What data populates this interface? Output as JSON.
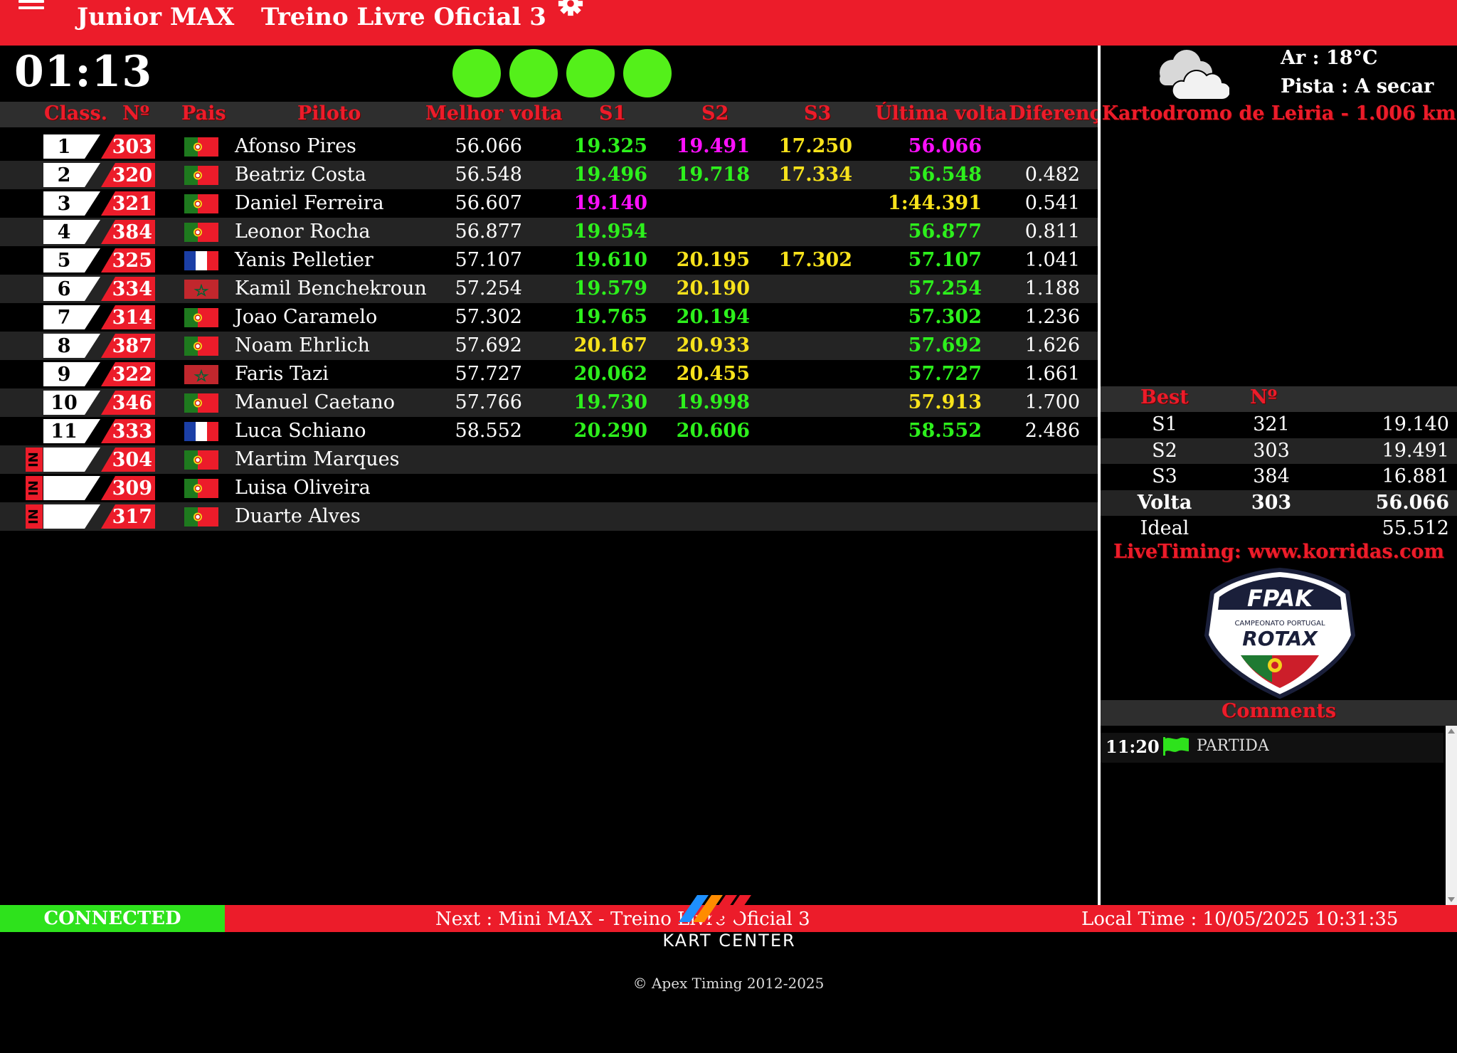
{
  "header": {
    "category": "Junior MAX",
    "session": "Treino Livre Oficial 3"
  },
  "clock": "01:13",
  "lights": [
    "#54f01a",
    "#54f01a",
    "#54f01a",
    "#54f01a"
  ],
  "table": {
    "headers": [
      "Class.",
      "Nº",
      "Pais",
      "Piloto",
      "Melhor volta",
      "S1",
      "S2",
      "S3",
      "Última volta",
      "Diferenç"
    ],
    "rows": [
      {
        "pos": "1",
        "num": "303",
        "flag": "PT",
        "pilot": "Afonso Pires",
        "best": "56.066",
        "s1": "19.325",
        "s1c": "green",
        "s2": "19.491",
        "s2c": "purple",
        "s3": "17.250",
        "s3c": "yellow",
        "last": "56.066",
        "lastc": "purple",
        "gap": ""
      },
      {
        "pos": "2",
        "num": "320",
        "flag": "PT",
        "pilot": "Beatriz Costa",
        "best": "56.548",
        "s1": "19.496",
        "s1c": "green",
        "s2": "19.718",
        "s2c": "green",
        "s3": "17.334",
        "s3c": "yellow",
        "last": "56.548",
        "lastc": "green",
        "gap": "0.482"
      },
      {
        "pos": "3",
        "num": "321",
        "flag": "PT",
        "pilot": "Daniel Ferreira",
        "best": "56.607",
        "s1": "19.140",
        "s1c": "purple",
        "s2": "",
        "s2c": "white",
        "s3": "",
        "s3c": "white",
        "last": "1:44.391",
        "lastc": "yellow",
        "gap": "0.541"
      },
      {
        "pos": "4",
        "num": "384",
        "flag": "PT",
        "pilot": "Leonor Rocha",
        "best": "56.877",
        "s1": "19.954",
        "s1c": "green",
        "s2": "",
        "s2c": "white",
        "s3": "",
        "s3c": "white",
        "last": "56.877",
        "lastc": "green",
        "gap": "0.811"
      },
      {
        "pos": "5",
        "num": "325",
        "flag": "FR",
        "pilot": "Yanis Pelletier",
        "best": "57.107",
        "s1": "19.610",
        "s1c": "green",
        "s2": "20.195",
        "s2c": "yellow",
        "s3": "17.302",
        "s3c": "yellow",
        "last": "57.107",
        "lastc": "green",
        "gap": "1.041"
      },
      {
        "pos": "6",
        "num": "334",
        "flag": "MA",
        "pilot": "Kamil Benchekroun",
        "best": "57.254",
        "s1": "19.579",
        "s1c": "green",
        "s2": "20.190",
        "s2c": "yellow",
        "s3": "",
        "s3c": "white",
        "last": "57.254",
        "lastc": "green",
        "gap": "1.188"
      },
      {
        "pos": "7",
        "num": "314",
        "flag": "PT",
        "pilot": "Joao Caramelo",
        "best": "57.302",
        "s1": "19.765",
        "s1c": "green",
        "s2": "20.194",
        "s2c": "green",
        "s3": "",
        "s3c": "white",
        "last": "57.302",
        "lastc": "green",
        "gap": "1.236"
      },
      {
        "pos": "8",
        "num": "387",
        "flag": "PT",
        "pilot": "Noam Ehrlich",
        "best": "57.692",
        "s1": "20.167",
        "s1c": "yellow",
        "s2": "20.933",
        "s2c": "yellow",
        "s3": "",
        "s3c": "white",
        "last": "57.692",
        "lastc": "green",
        "gap": "1.626"
      },
      {
        "pos": "9",
        "num": "322",
        "flag": "MA",
        "pilot": "Faris Tazi",
        "best": "57.727",
        "s1": "20.062",
        "s1c": "green",
        "s2": "20.455",
        "s2c": "yellow",
        "s3": "",
        "s3c": "white",
        "last": "57.727",
        "lastc": "green",
        "gap": "1.661"
      },
      {
        "pos": "10",
        "num": "346",
        "flag": "PT",
        "pilot": "Manuel Caetano",
        "best": "57.766",
        "s1": "19.730",
        "s1c": "green",
        "s2": "19.998",
        "s2c": "green",
        "s3": "",
        "s3c": "white",
        "last": "57.913",
        "lastc": "yellow",
        "gap": "1.700"
      },
      {
        "pos": "11",
        "num": "333",
        "flag": "FR",
        "pilot": "Luca Schiano",
        "best": "58.552",
        "s1": "20.290",
        "s1c": "green",
        "s2": "20.606",
        "s2c": "green",
        "s3": "",
        "s3c": "white",
        "last": "58.552",
        "lastc": "green",
        "gap": "2.486"
      },
      {
        "pos": "",
        "status": "IN",
        "num": "304",
        "flag": "PT",
        "pilot": "Martim Marques",
        "best": "",
        "s1": "",
        "s1c": "white",
        "s2": "",
        "s2c": "white",
        "s3": "",
        "s3c": "white",
        "last": "",
        "lastc": "white",
        "gap": ""
      },
      {
        "pos": "",
        "status": "IN",
        "num": "309",
        "flag": "PT",
        "pilot": "Luisa Oliveira",
        "best": "",
        "s1": "",
        "s1c": "white",
        "s2": "",
        "s2c": "white",
        "s3": "",
        "s3c": "white",
        "last": "",
        "lastc": "white",
        "gap": ""
      },
      {
        "pos": "",
        "status": "IN",
        "num": "317",
        "flag": "PT",
        "pilot": "Duarte Alves",
        "best": "",
        "s1": "",
        "s1c": "white",
        "s2": "",
        "s2c": "white",
        "s3": "",
        "s3c": "white",
        "last": "",
        "lastc": "white",
        "gap": ""
      }
    ]
  },
  "weather": {
    "icon": "cloud-icon",
    "air": "Ar : 18°C",
    "track_state": "Pista : A secar"
  },
  "track": "Kartodromo de Leiria - 1.006 km",
  "best": {
    "headers": [
      "Best",
      "Nº"
    ],
    "rows": [
      {
        "label": "S1",
        "num": "321",
        "time": "19.140"
      },
      {
        "label": "S2",
        "num": "303",
        "time": "19.491"
      },
      {
        "label": "S3",
        "num": "384",
        "time": "16.881"
      },
      {
        "label": "Volta",
        "num": "303",
        "time": "56.066"
      },
      {
        "label": "Ideal",
        "num": "",
        "time": "55.512"
      }
    ]
  },
  "livetiming": "LiveTiming: www.korridas.com",
  "logo": {
    "top": "FPAK",
    "middle": "CAMPEONATO PORTUGAL",
    "bottom": "ROTAX"
  },
  "comments": {
    "title": "Comments",
    "items": [
      {
        "time": "11:20",
        "flag": "green-flag-icon",
        "text": "PARTIDA"
      }
    ]
  },
  "footer": {
    "status": "CONNECTED",
    "next": "Next : Mini MAX - Treino Livre Oficial 3",
    "local_time": "Local Time : 10/05/2025 10:31:35",
    "brand": "KART CENTER",
    "copyright": "© Apex Timing 2012-2025"
  },
  "colors": {
    "accent_red": "#ec1c2a",
    "personal_best": "#2df01c",
    "overall_best": "#ff10ff",
    "slower": "#f7e21b",
    "connected": "#2ee21c"
  }
}
